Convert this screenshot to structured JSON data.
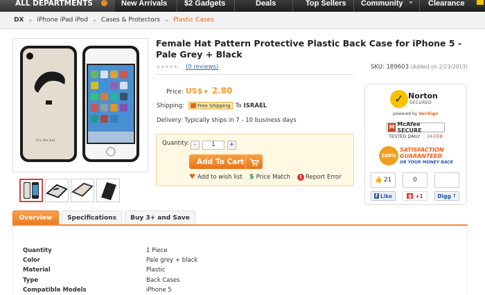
{
  "nav": {
    "departments": "ALL DEPARTMENTS",
    "items": [
      "New Arrivals",
      "$2 Gadgets",
      "Deals",
      "Top Sellers",
      "Community",
      "Clearance"
    ]
  },
  "breadcrumb": [
    "DX",
    "iPhone iPad iPod",
    "Cases & Protectors",
    "Plastic Cases"
  ],
  "product": {
    "title": "Female Hat Pattern Protective Plastic Back Case for iPhone 5 - Pale Grey + Black",
    "reviews": "(0 reviews)",
    "sku_label": "SKU: 189603",
    "added": "(Added on 2/23/2013)",
    "price_label": "Price:",
    "currency": "US$",
    "price": "2.80",
    "shipping_label": "Shipping:",
    "free_shipping": "Free Shipping",
    "ship_to": "To",
    "country": "ISRAEL",
    "delivery": "Delivery:  Typically ships in 7 - 10 business days",
    "image_caption": "It's the hat"
  },
  "cart": {
    "quantity_label": "Quantity:",
    "minus": "-",
    "plus": "+",
    "quantity": "1",
    "add_to_cart": "Add To Cart",
    "wishlist": "Add to wish list",
    "price_match": "Price Match",
    "report_error": "Report Error"
  },
  "trust": {
    "norton": "Norton",
    "secured": "SECURED",
    "powered_by": "powered by VeriSign",
    "powered_by_prefix": "powered by ",
    "powered_by_brand": "VeriSign",
    "mcafee": "McAfee SECURE",
    "tested_daily": "TESTED DAILY",
    "tested_date": "24-FEB",
    "satisfaction_seal": "100%",
    "satisfaction": "SATISFACTION",
    "guaranteed": "GUARANTEED",
    "money_back": "OR YOUR MONEY BACK"
  },
  "social": {
    "facebook_count": "21",
    "facebook_label": "Like",
    "gplus_count": "0",
    "gplus_label": "+1",
    "digg_count": "",
    "digg_label": "Digg"
  },
  "tabs": [
    "Overview",
    "Specifications",
    "Buy 3+ and Save"
  ],
  "specs": [
    {
      "key": "Quantity",
      "value": "1 Piece"
    },
    {
      "key": "Color",
      "value": "Pale grey + black"
    },
    {
      "key": "Material",
      "value": "Plastic"
    },
    {
      "key": "Type",
      "value": "Back Cases"
    },
    {
      "key": "Compatible Models",
      "value": "iPhone 5"
    }
  ]
}
